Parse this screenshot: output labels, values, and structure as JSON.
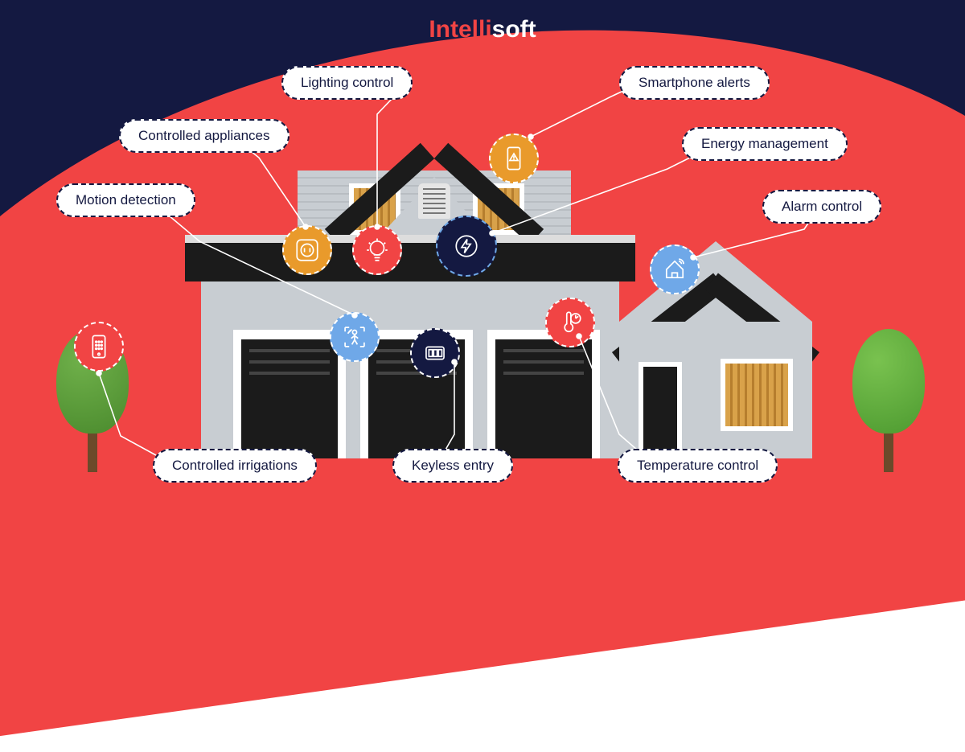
{
  "brand": {
    "part1": "Intelli",
    "part2": "soft"
  },
  "colors": {
    "bg_navy": "#141941",
    "accent_red": "#f14444",
    "icon_orange": "#e99a2b",
    "icon_blue": "#6fa8e8",
    "house_wall": "#c8cdd2",
    "house_roof": "#1b1b1b"
  },
  "labels": {
    "lighting": "Lighting control",
    "appliances": "Controlled appliances",
    "motion": "Motion detection",
    "irrigations": "Controlled irrigations",
    "keyless": "Keyless entry",
    "temperature": "Temperature control",
    "smartphone": "Smartphone alerts",
    "energy": "Energy management",
    "alarm": "Alarm control"
  },
  "icons": {
    "outlet": "outlet-icon",
    "bulb": "bulb-icon",
    "bolt_circle": "bolt-circle-icon",
    "phone_alert": "phone-alert-icon",
    "motion_person": "motion-person-icon",
    "keypad": "keypad-icon",
    "thermometer": "thermometer-icon",
    "house_alarm": "house-alarm-icon",
    "phone_remote": "phone-remote-icon"
  }
}
